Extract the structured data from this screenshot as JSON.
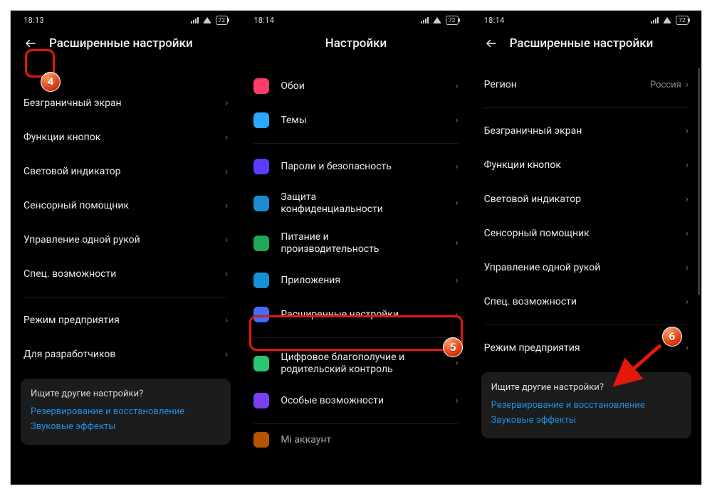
{
  "screens": {
    "left": {
      "time": "18:13",
      "battery": "72",
      "title": "Расширенные настройки",
      "items": [
        "Безграничный экран",
        "Функции кнопок",
        "Световой индикатор",
        "Сенсорный помощник",
        "Управление одной рукой",
        "Спец. возможности"
      ],
      "items2": [
        "Режим предприятия",
        "Для разработчиков"
      ],
      "suggest": {
        "q": "Ищите другие настройки?",
        "l1": "Резервирование и восстановление",
        "l2": "Звуковые эффекты"
      }
    },
    "mid": {
      "time": "18:14",
      "battery": "72",
      "title": "Настройки",
      "items": [
        {
          "icon": "ic-wall",
          "label": "Обои"
        },
        {
          "icon": "ic-theme",
          "label": "Темы"
        }
      ],
      "items2": [
        {
          "icon": "ic-pass",
          "label": "Пароли и безопасность"
        },
        {
          "icon": "ic-priv",
          "label": "Защита\nконфиденциальности"
        },
        {
          "icon": "ic-batt",
          "label": "Питание и\nпроизводительность"
        },
        {
          "icon": "ic-apps",
          "label": "Приложения"
        },
        {
          "icon": "ic-more",
          "label": "Расширенные настройки"
        }
      ],
      "items3": [
        {
          "icon": "ic-well",
          "label": "Цифровое благополучие и\nродительский контроль"
        },
        {
          "icon": "ic-spec",
          "label": "Особые возможности"
        }
      ],
      "mi": {
        "icon": "ic-mi",
        "label": "Mi аккаунт"
      }
    },
    "right": {
      "time": "18:14",
      "battery": "72",
      "title": "Расширенные настройки",
      "region": {
        "label": "Регион",
        "value": "Россия"
      },
      "items": [
        "Безграничный экран",
        "Функции кнопок",
        "Световой индикатор",
        "Сенсорный помощник",
        "Управление одной рукой",
        "Спец. возможности"
      ],
      "items2": [
        "Режим предприятия"
      ],
      "suggest": {
        "q": "Ищите другие настройки?",
        "l1": "Резервирование и восстановление",
        "l2": "Звуковые эффекты"
      }
    }
  },
  "annotations": {
    "step4": "4",
    "step5": "5",
    "step6": "6"
  }
}
